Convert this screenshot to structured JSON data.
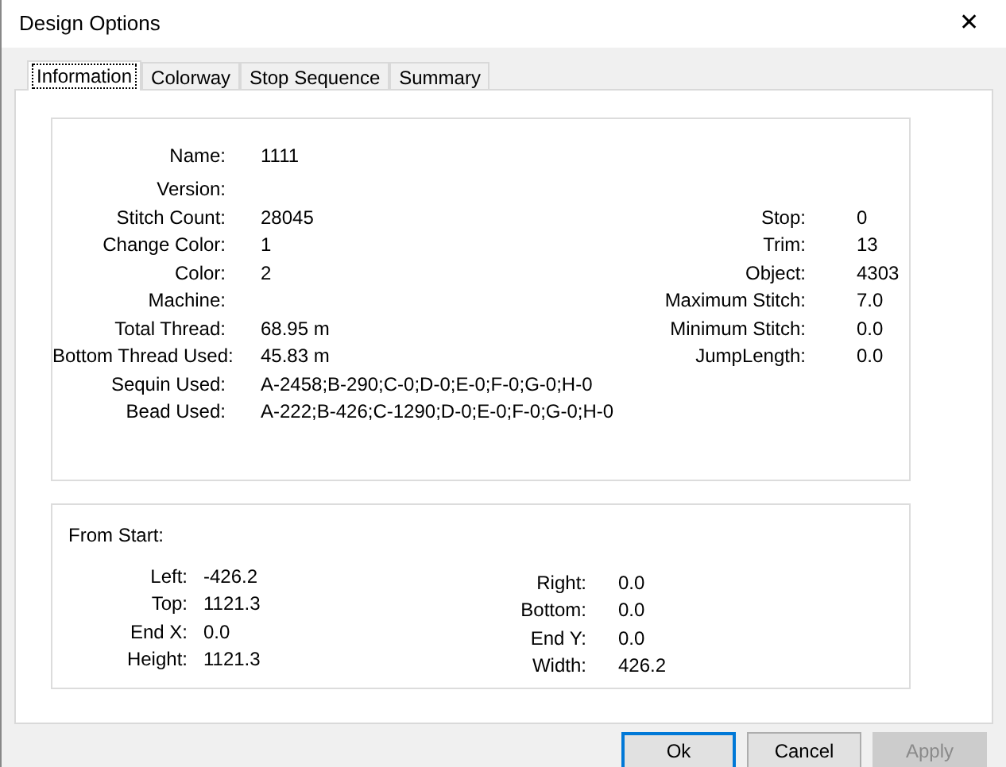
{
  "window": {
    "title": "Design Options",
    "close": "✕"
  },
  "tabs": [
    {
      "label": "Information",
      "selected": true
    },
    {
      "label": "Colorway",
      "selected": false
    },
    {
      "label": "Stop Sequence",
      "selected": false
    },
    {
      "label": "Summary",
      "selected": false
    }
  ],
  "info": {
    "left": [
      {
        "label": "Name:",
        "value": "1111"
      },
      {
        "label": "Version:"
      },
      {
        "label": "Stitch Count:",
        "value": "28045"
      },
      {
        "label": "Change Color:",
        "value": "1"
      },
      {
        "label": "Color:",
        "value": "2"
      },
      {
        "label": "Machine:"
      },
      {
        "label": "Total Thread:",
        "value": "68.95 m"
      },
      {
        "label": "Bottom Thread Used:",
        "value": "45.83 m"
      },
      {
        "label": "Sequin Used:",
        "value": "A-2458;B-290;C-0;D-0;E-0;F-0;G-0;H-0"
      },
      {
        "label": "Bead Used:",
        "value": "A-222;B-426;C-1290;D-0;E-0;F-0;G-0;H-0"
      }
    ],
    "right": [
      {
        "label": "Stop:",
        "value": "0"
      },
      {
        "label": "Trim:",
        "value": "13"
      },
      {
        "label": "Object:",
        "value": "4303"
      },
      {
        "label": "Maximum Stitch:",
        "value": "7.0"
      },
      {
        "label": "Minimum Stitch:",
        "value": "0.0"
      },
      {
        "label": "JumpLength:",
        "value": "0.0"
      }
    ]
  },
  "from_start": {
    "title": "From Start:",
    "left": [
      {
        "label": "Left:",
        "value": "-426.2"
      },
      {
        "label": "Top:",
        "value": "1121.3"
      },
      {
        "label": "End X:",
        "value": "0.0"
      },
      {
        "label": "Height:",
        "value": "1121.3"
      }
    ],
    "right": [
      {
        "label": "Right:",
        "value": "0.0"
      },
      {
        "label": "Bottom:",
        "value": "0.0"
      },
      {
        "label": "End Y:",
        "value": "0.0"
      },
      {
        "label": "Width:",
        "value": "426.2"
      }
    ]
  },
  "buttons": [
    {
      "label": "Ok",
      "default": true,
      "disabled": false
    },
    {
      "label": "Cancel",
      "default": false,
      "disabled": false
    },
    {
      "label": "Apply",
      "default": false,
      "disabled": true
    }
  ]
}
